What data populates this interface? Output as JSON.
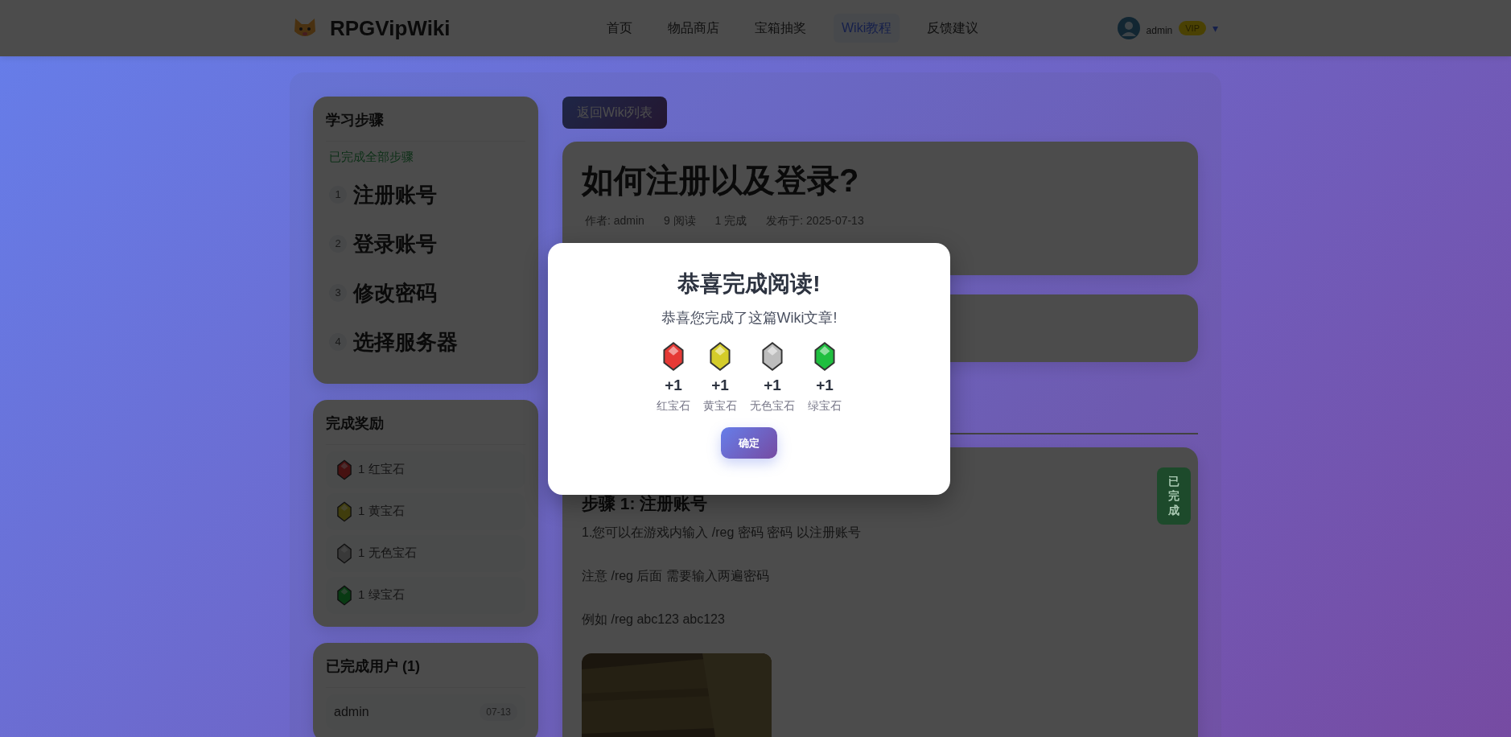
{
  "header": {
    "logo_text": "RPGVipWiki",
    "nav": [
      {
        "label": "首页",
        "selected": false
      },
      {
        "label": "物品商店",
        "selected": false
      },
      {
        "label": "宝箱抽奖",
        "selected": false
      },
      {
        "label": "Wiki教程",
        "selected": true
      },
      {
        "label": "反馈建议",
        "selected": false
      }
    ],
    "user": {
      "name": "admin",
      "badge": "VIP",
      "caret": "▾"
    }
  },
  "sidebar": {
    "steps_card": {
      "title": "学习步骤",
      "status": "已完成全部步骤",
      "steps": [
        {
          "number": "1",
          "label": "注册账号"
        },
        {
          "number": "2",
          "label": "登录账号"
        },
        {
          "number": "3",
          "label": "修改密码"
        },
        {
          "number": "4",
          "label": "选择服务器"
        }
      ]
    },
    "rewards_card": {
      "title": "完成奖励",
      "items": [
        {
          "text": "1 红宝石",
          "color": "#461111"
        },
        {
          "text": "1 黄宝石",
          "color": "#403d0d"
        },
        {
          "text": "1 无色宝石",
          "color": "#393939"
        },
        {
          "text": "1 绿宝石",
          "color": "#093a13"
        }
      ]
    },
    "users_card": {
      "title": "已完成用户 (1)",
      "users": [
        {
          "name": "admin",
          "date": "07-13"
        }
      ]
    }
  },
  "article": {
    "back_button": "返回Wiki列表",
    "title": "如何注册以及登录?",
    "meta": [
      "作者: admin",
      "9 阅读",
      "1 完成",
      "发布于: 2025-07-13"
    ],
    "step": {
      "title": "步骤 1: 注册账号",
      "done_badge": "已完成",
      "paragraphs": [
        "1.您可以在游戏内输入 /reg 密码 密码 以注册账号",
        "注意 /reg 后面 需要输入两遍密码",
        "例如 /reg abc123 abc123"
      ],
      "image": {
        "kind": "picture"
      }
    }
  },
  "modal": {
    "title": "恭喜完成阅读!",
    "message": "恭喜您完成了这篇Wiki文章!",
    "rewards": [
      {
        "amount": "+1",
        "label": "红宝石",
        "color": "#e53935"
      },
      {
        "amount": "+1",
        "label": "黄宝石",
        "color": "#d4cc2a"
      },
      {
        "amount": "+1",
        "label": "无色宝石",
        "color": "#bdbdbd"
      },
      {
        "amount": "+1",
        "label": "绿宝石",
        "color": "#1fbf3f"
      }
    ],
    "confirm_button": "确定"
  }
}
